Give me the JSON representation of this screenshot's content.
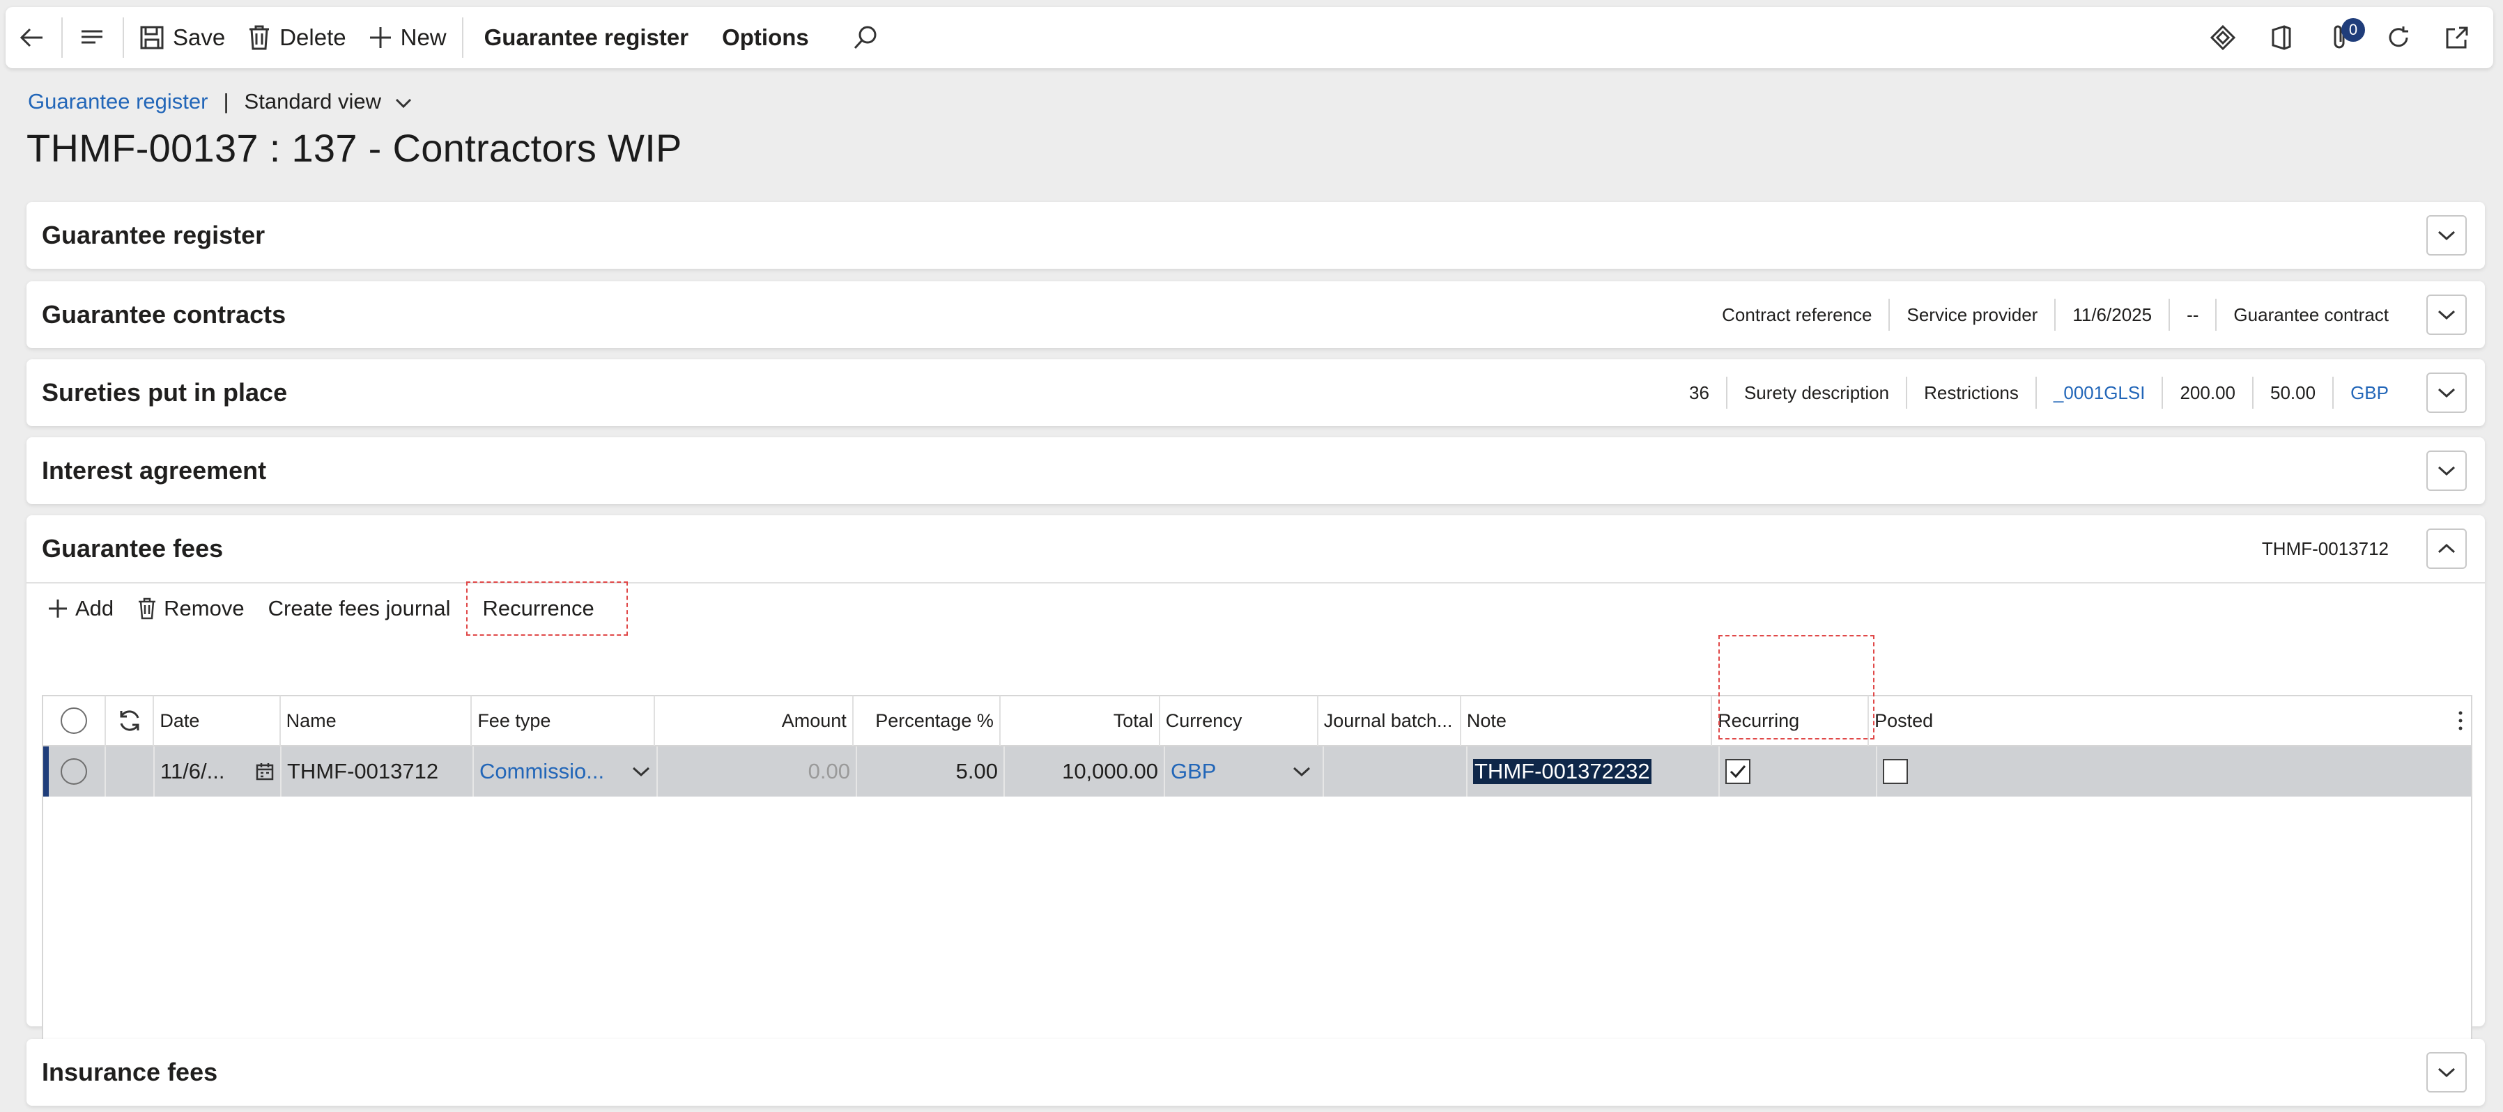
{
  "toolbar": {
    "save": "Save",
    "delete": "Delete",
    "new": "New",
    "guarantee_register": "Guarantee register",
    "options": "Options",
    "attachments_count": "0"
  },
  "breadcrumb": {
    "link": "Guarantee register",
    "separator": "|",
    "view": "Standard view"
  },
  "page_title": "THMF-00137 : 137 - Contractors WIP",
  "sections": {
    "guarantee_register": {
      "title": "Guarantee register"
    },
    "guarantee_contracts": {
      "title": "Guarantee contracts",
      "summary": [
        "Contract reference",
        "Service provider",
        "11/6/2025",
        "--",
        "Guarantee contract"
      ]
    },
    "sureties": {
      "title": "Sureties put in place",
      "summary": [
        "36",
        "Surety description",
        "Restrictions",
        "_0001GLSI",
        "200.00",
        "50.00",
        "GBP"
      ]
    },
    "interest_agreement": {
      "title": "Interest agreement"
    },
    "guarantee_fees": {
      "title": "Guarantee fees",
      "summary": "THMF-0013712",
      "actions": {
        "add": "Add",
        "remove": "Remove",
        "create_journal": "Create fees journal",
        "recurrence": "Recurrence"
      },
      "columns": {
        "date": "Date",
        "name": "Name",
        "fee_type": "Fee type",
        "amount": "Amount",
        "percentage": "Percentage %",
        "total": "Total",
        "currency": "Currency",
        "journal_batch": "Journal batch...",
        "note": "Note",
        "recurring": "Recurring",
        "posted": "Posted"
      },
      "rows": [
        {
          "date": "11/6/...",
          "name": "THMF-0013712",
          "fee_type": "Commissio...",
          "amount": "0.00",
          "percentage": "5.00",
          "total": "10,000.00",
          "currency": "GBP",
          "journal_batch": "",
          "note": "THMF-001372232",
          "recurring": true,
          "posted": false
        }
      ]
    },
    "insurance_fees": {
      "title": "Insurance fees"
    }
  },
  "colors": {
    "link": "#2266b8",
    "accent": "#1f3d7a",
    "highlight": "#e04848"
  }
}
